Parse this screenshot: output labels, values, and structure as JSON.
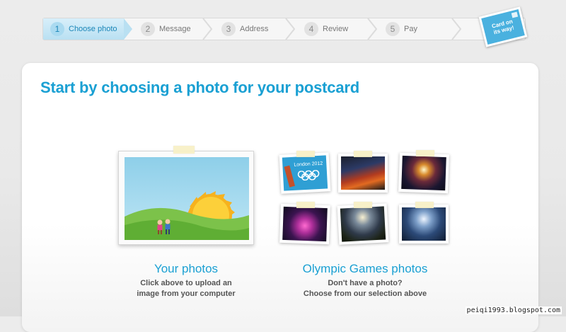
{
  "steps": [
    {
      "num": "1",
      "label": "Choose photo",
      "active": true
    },
    {
      "num": "2",
      "label": "Message",
      "active": false
    },
    {
      "num": "3",
      "label": "Address",
      "active": false
    },
    {
      "num": "4",
      "label": "Review",
      "active": false
    },
    {
      "num": "5",
      "label": "Pay",
      "active": false
    }
  ],
  "stamp": {
    "line1": "Card on",
    "line2": "its way!"
  },
  "main": {
    "title": "Start by choosing a photo for your postcard",
    "your_photos": {
      "title": "Your photos",
      "line1": "Click above to upload an",
      "line2": "image from your computer"
    },
    "olympic": {
      "title": "Olympic Games photos",
      "line1": "Don't have a photo?",
      "line2": "Choose from our selection above",
      "thumb1_caption": "London 2012"
    }
  },
  "watermark": "peiqi1993.blogspot.com",
  "colors": {
    "accent": "#1aa0d3",
    "active_step_bg": "#c3e5f5"
  }
}
